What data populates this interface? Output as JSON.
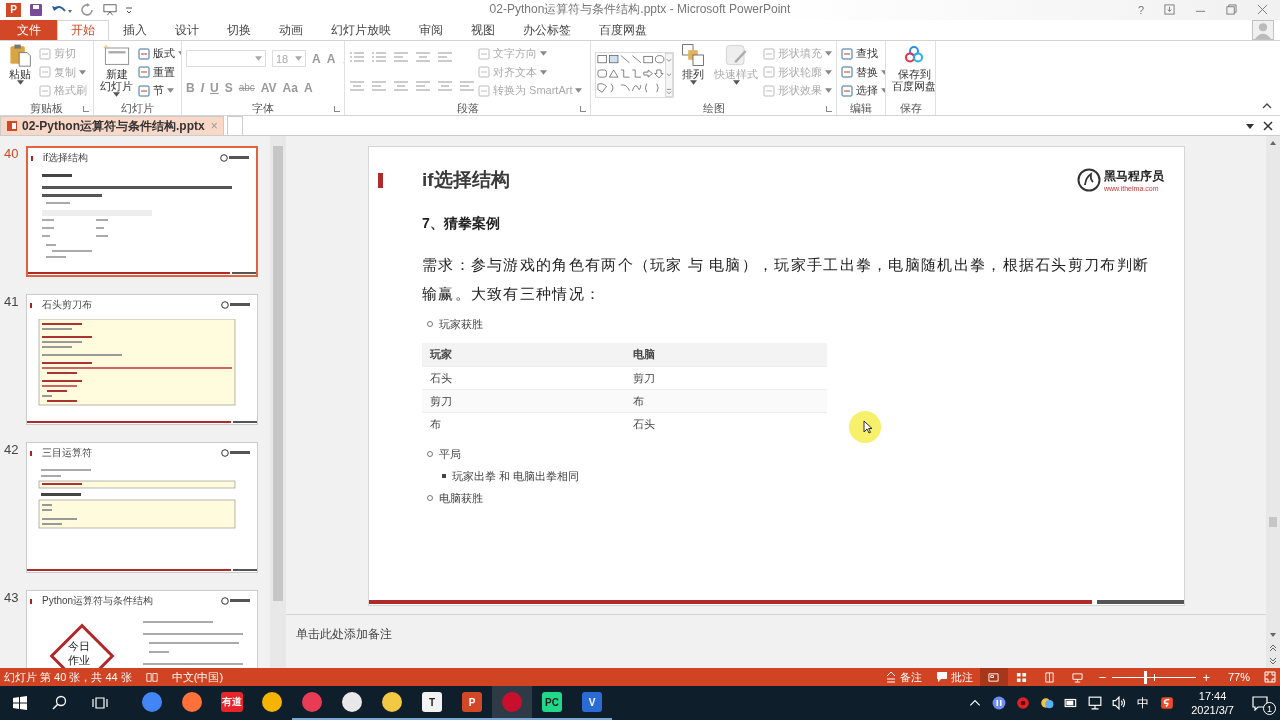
{
  "window": {
    "app_badge": "P",
    "title": "02-Python运算符与条件结构.pptx - Microsoft PowerPoint",
    "help": "?"
  },
  "ribbon_tabs": [
    {
      "label": "文件",
      "kind": "file",
      "selected": false
    },
    {
      "label": "开始",
      "kind": "tab",
      "selected": true
    },
    {
      "label": "插入",
      "kind": "tab",
      "selected": false
    },
    {
      "label": "设计",
      "kind": "tab",
      "selected": false
    },
    {
      "label": "切换",
      "kind": "tab",
      "selected": false
    },
    {
      "label": "动画",
      "kind": "tab",
      "selected": false
    },
    {
      "label": "幻灯片放映",
      "kind": "tab",
      "selected": false
    },
    {
      "label": "审阅",
      "kind": "tab",
      "selected": false
    },
    {
      "label": "视图",
      "kind": "tab",
      "selected": false
    },
    {
      "label": "办公标签",
      "kind": "tab",
      "selected": false
    },
    {
      "label": "百度网盘",
      "kind": "tab",
      "selected": false
    }
  ],
  "ribbon_groups": [
    {
      "label": "剪贴板",
      "launcher": true,
      "items": [
        {
          "kind": "large",
          "lines": [
            "粘贴"
          ],
          "dropdown": true,
          "disabled": false
        },
        {
          "kind": "stack",
          "entries": [
            {
              "label": "剪切",
              "disabled": true,
              "dropdown": false
            },
            {
              "label": "复制",
              "disabled": true,
              "dropdown": true
            },
            {
              "label": "格式刷",
              "disabled": true,
              "dropdown": false
            }
          ]
        }
      ]
    },
    {
      "label": "幻灯片",
      "launcher": false,
      "items": [
        {
          "kind": "large",
          "lines": [
            "新建",
            "幻灯片"
          ],
          "dropdown": true,
          "disabled": false
        },
        {
          "kind": "stack",
          "entries": [
            {
              "label": "版式",
              "disabled": false,
              "dropdown": true
            },
            {
              "label": "重置",
              "disabled": false,
              "dropdown": false
            },
            {
              "label": "节",
              "disabled": false,
              "dropdown": true
            }
          ]
        }
      ]
    },
    {
      "label": "字体",
      "launcher": true,
      "items": [
        {
          "kind": "font",
          "size": "18",
          "sizers": [
            "A",
            "A"
          ],
          "tools": [
            "B",
            "I",
            "U",
            "S",
            "abc",
            "AV",
            "Aa",
            "A"
          ]
        }
      ]
    },
    {
      "label": "段落",
      "launcher": true,
      "items": [
        {
          "kind": "paragraph"
        },
        {
          "kind": "stack",
          "entries": [
            {
              "label": "文字方向",
              "disabled": true,
              "dropdown": true
            },
            {
              "label": "对齐文本",
              "disabled": true,
              "dropdown": true
            },
            {
              "label": "转换为 SmartArt",
              "disabled": true,
              "dropdown": true
            }
          ]
        }
      ]
    },
    {
      "label": "绘图",
      "launcher": true,
      "items": [
        {
          "kind": "gallery"
        },
        {
          "kind": "large",
          "lines": [
            "排列"
          ],
          "dropdown": true,
          "disabled": false
        },
        {
          "kind": "large",
          "lines": [
            "快速样式"
          ],
          "dropdown": true,
          "disabled": true
        },
        {
          "kind": "stack",
          "entries": [
            {
              "label": "形状填充",
              "disabled": true,
              "dropdown": true
            },
            {
              "label": "形状轮廓",
              "disabled": true,
              "dropdown": true
            },
            {
              "label": "形状效果",
              "disabled": true,
              "dropdown": true
            }
          ]
        }
      ]
    },
    {
      "label": "编辑",
      "launcher": false,
      "items": [
        {
          "kind": "stack",
          "entries": [
            {
              "label": "查找",
              "disabled": false,
              "dropdown": false
            },
            {
              "label": "替换",
              "disabled": false,
              "dropdown": true
            },
            {
              "label": "选择",
              "disabled": false,
              "dropdown": true
            }
          ]
        }
      ]
    },
    {
      "label": "保存",
      "launcher": false,
      "items": [
        {
          "kind": "large",
          "lines": [
            "保存到",
            "百度网盘"
          ],
          "dropdown": false,
          "disabled": false
        }
      ]
    }
  ],
  "document_tabs": [
    {
      "label": "02-Python运算符与条件结构.pptx",
      "close": "×",
      "selected": true
    }
  ],
  "thumbnails": [
    {
      "number": "40",
      "title": "if选择结构",
      "kind": "text",
      "selected": true
    },
    {
      "number": "41",
      "title": "石头剪刀布",
      "kind": "code",
      "selected": false
    },
    {
      "number": "42",
      "title": "三目运算符",
      "kind": "code2",
      "selected": false
    },
    {
      "number": "43",
      "title": "Python运算符与条件结构",
      "kind": "homework",
      "badge": [
        "今日",
        "作业"
      ],
      "selected": false
    }
  ],
  "slide": {
    "title": "if选择结构",
    "logo": {
      "name": "黑马程序员",
      "url": "www.itheima.com"
    },
    "heading": "7、猜拳案例",
    "paragraph": "需求：参与游戏的角色有两个（玩家 与 电脑），玩家手工出拳，电脑随机出拳，根据石头剪刀布判断输赢。大致有三种情况：",
    "outline": [
      {
        "kind": "bullet",
        "text": "玩家获胜"
      },
      {
        "kind": "table",
        "columns": [
          "玩家",
          "电脑"
        ],
        "rows": [
          [
            "石头",
            "剪刀"
          ],
          [
            "剪刀",
            "布"
          ],
          [
            "布",
            "石头"
          ]
        ]
      },
      {
        "kind": "bullet",
        "text": "平局",
        "children": [
          {
            "text": "玩家出拳 和 电脑出拳相同"
          }
        ]
      },
      {
        "kind": "bullet",
        "text": "电脑获胜"
      }
    ]
  },
  "notes": {
    "placeholder": "单击此处添加备注"
  },
  "status_bar": {
    "slide_info": "幻灯片 第 40 张，共 44 张",
    "language": "中文(中国)",
    "notes": "备注",
    "comments": "批注",
    "views": [
      {
        "selected": true
      },
      {
        "selected": false
      },
      {
        "selected": false
      },
      {
        "selected": false
      }
    ],
    "zoom": {
      "minus": "−",
      "plus": "+",
      "level": 0.39,
      "percent": "77%"
    }
  },
  "taskbar": {
    "apps": [
      {
        "color": "#4285f4",
        "running": false,
        "selected": false
      },
      {
        "color": "#ff7139",
        "running": false,
        "selected": false
      },
      {
        "color": "#e8232a",
        "glyph": "有道",
        "running": false,
        "selected": false
      },
      {
        "color": "#f4b400",
        "running": false,
        "selected": false
      },
      {
        "color": "#e83c56",
        "running": true,
        "selected": false
      },
      {
        "color": "#e8e8e8",
        "running": true,
        "selected": false
      },
      {
        "color": "#f3c845",
        "running": true,
        "selected": false
      },
      {
        "color": "#f2f2f2",
        "glyph": "T",
        "running": true,
        "selected": false
      },
      {
        "color": "#d24726",
        "glyph": "P",
        "running": true,
        "selected": false
      },
      {
        "color": "#c8102e",
        "running": true,
        "selected": true
      },
      {
        "color": "#21d789",
        "glyph": "PC",
        "running": true,
        "selected": false
      },
      {
        "color": "#2b6cd4",
        "glyph": "V",
        "running": true,
        "selected": false
      }
    ],
    "tray": {
      "ime": "中",
      "time": "17:44",
      "date": "2021/3/7",
      "notifications": "1"
    }
  }
}
